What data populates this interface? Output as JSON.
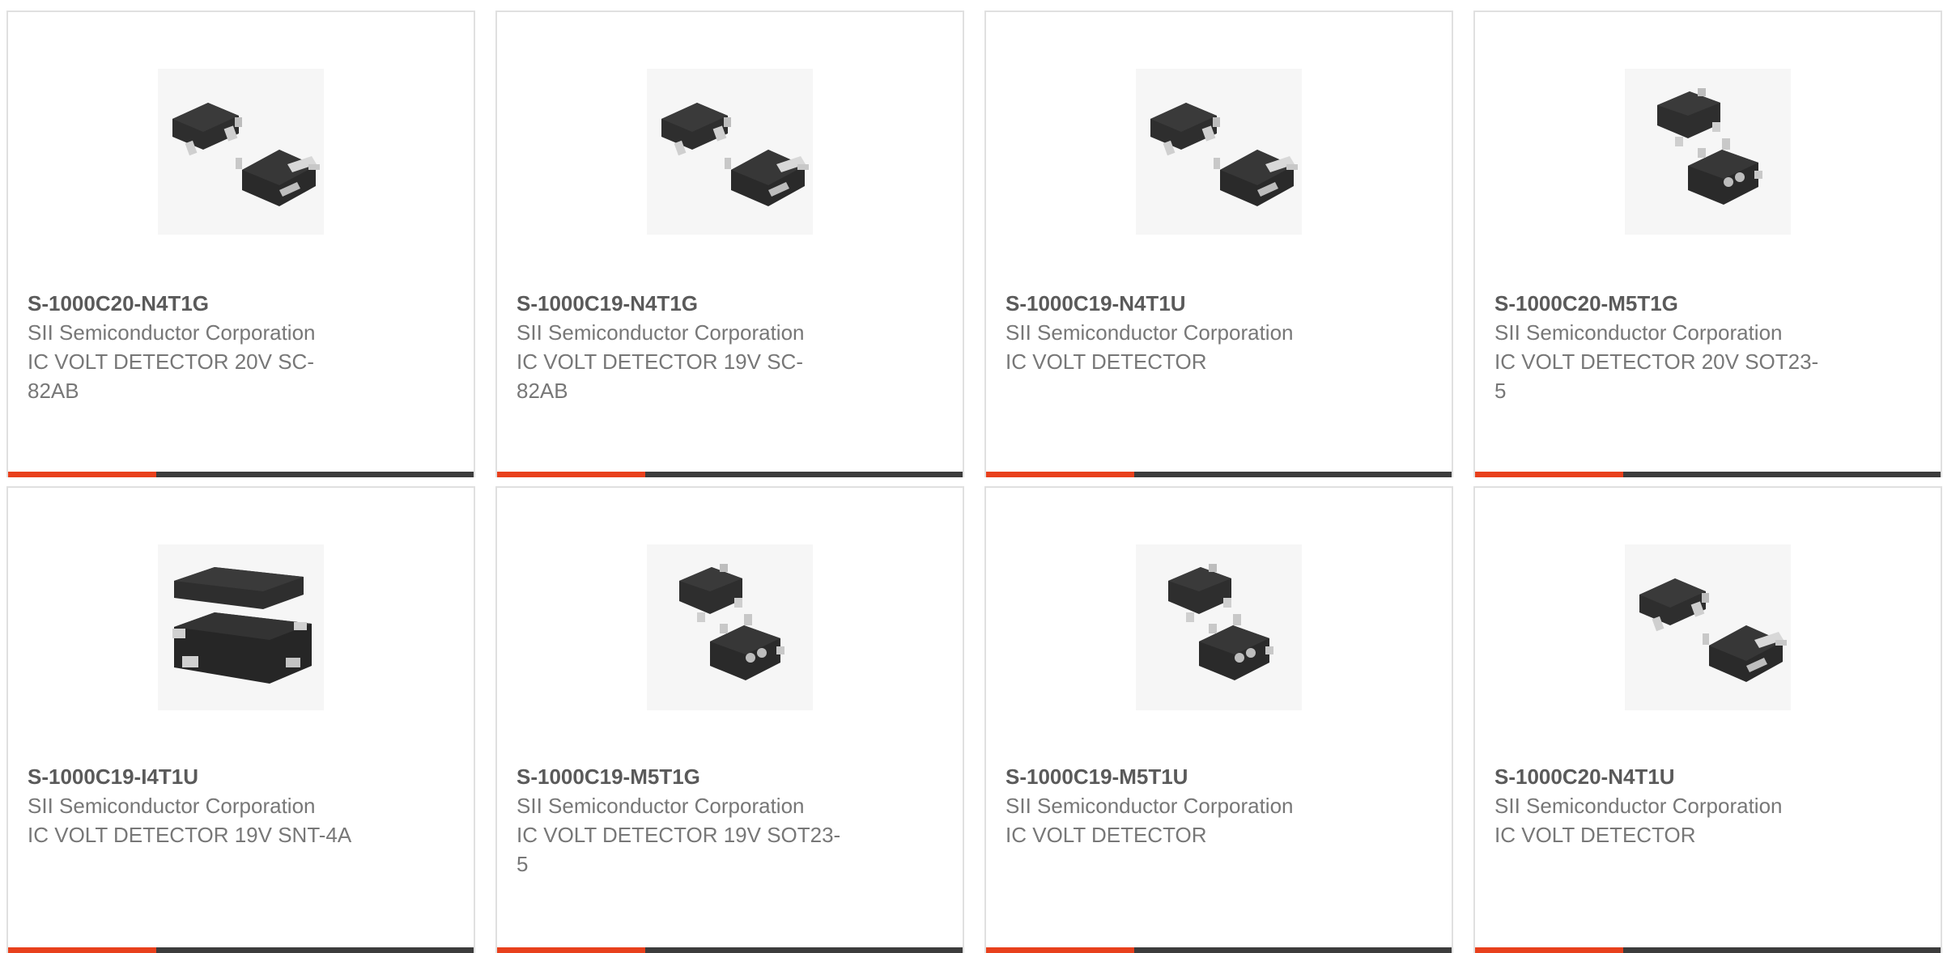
{
  "colors": {
    "accent": "#e8401c",
    "bar": "#3c3c3c",
    "border": "#e0e0e0",
    "part_number": "#5a5a5a",
    "body_text": "#777777"
  },
  "products": [
    {
      "part_number": "S-1000C20-N4T1G",
      "manufacturer": "SII Semiconductor Corporation",
      "description": "IC VOLT DETECTOR 20V SC-82AB",
      "image": "sc82ab-package-image"
    },
    {
      "part_number": "S-1000C19-N4T1G",
      "manufacturer": "SII Semiconductor Corporation",
      "description": "IC VOLT DETECTOR 19V SC-82AB",
      "image": "sc82ab-package-image"
    },
    {
      "part_number": "S-1000C19-N4T1U",
      "manufacturer": "SII Semiconductor Corporation",
      "description": "IC VOLT DETECTOR",
      "image": "sc82ab-package-image"
    },
    {
      "part_number": "S-1000C20-M5T1G",
      "manufacturer": "SII Semiconductor Corporation",
      "description": "IC VOLT DETECTOR 20V SOT23-5",
      "image": "sot23-5-package-image"
    },
    {
      "part_number": "S-1000C19-I4T1U",
      "manufacturer": "SII Semiconductor Corporation",
      "description": "IC VOLT DETECTOR 19V SNT-4A",
      "image": "snt-4a-package-image"
    },
    {
      "part_number": "S-1000C19-M5T1G",
      "manufacturer": "SII Semiconductor Corporation",
      "description": "IC VOLT DETECTOR 19V SOT23-5",
      "image": "sot23-5-package-image"
    },
    {
      "part_number": "S-1000C19-M5T1U",
      "manufacturer": "SII Semiconductor Corporation",
      "description": "IC VOLT DETECTOR",
      "image": "sot23-5-package-image"
    },
    {
      "part_number": "S-1000C20-N4T1U",
      "manufacturer": "SII Semiconductor Corporation",
      "description": "IC VOLT DETECTOR",
      "image": "sc82ab-package-image"
    }
  ]
}
